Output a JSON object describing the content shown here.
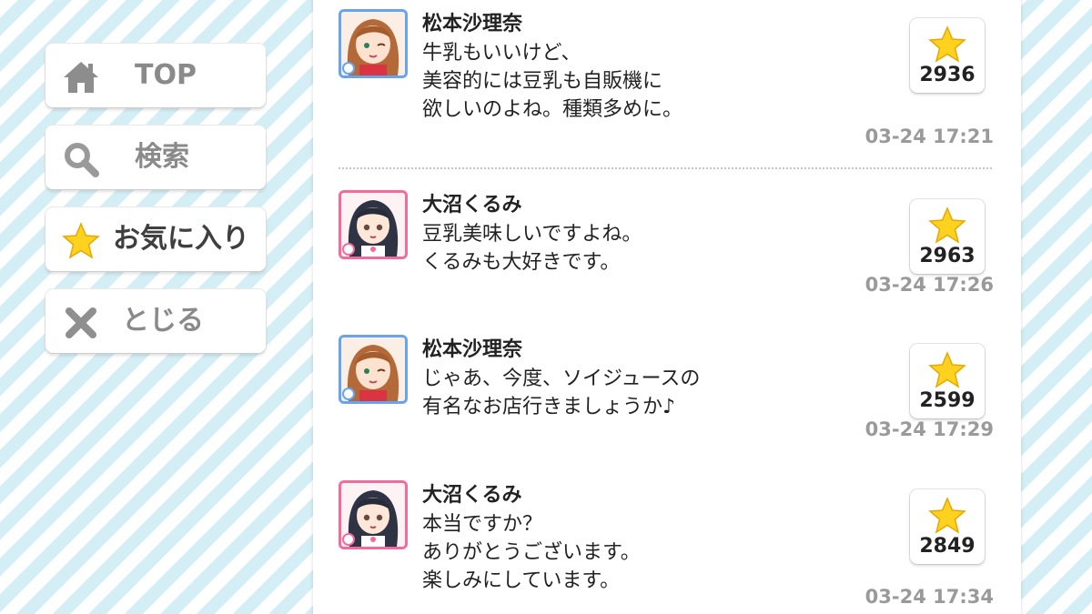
{
  "sidebar": {
    "items": [
      {
        "label": "TOP",
        "icon": "home-icon"
      },
      {
        "label": "検索",
        "icon": "search-icon"
      },
      {
        "label": "お気に入り",
        "icon": "star-icon"
      },
      {
        "label": "とじる",
        "icon": "close-icon"
      }
    ]
  },
  "colors": {
    "star": "#ffd700",
    "frame_blue": "#67a4ef",
    "frame_pink": "#f46a9d",
    "timestamp": "#9a9a9a"
  },
  "messages": [
    {
      "name": "松本沙理奈",
      "frame": "blue",
      "text": "牛乳もいいけど、\n美容的には豆乳も自販機に\n欲しいのよね。種類多めに。",
      "likes": "2936",
      "time": "03-24 17:21"
    },
    {
      "name": "大沼くるみ",
      "frame": "pink",
      "text": "豆乳美味しいですよね。\nくるみも大好きです。",
      "likes": "2963",
      "time": "03-24 17:26"
    },
    {
      "name": "松本沙理奈",
      "frame": "blue",
      "text": "じゃあ、今度、ソイジュースの\n有名なお店行きましょうか♪",
      "likes": "2599",
      "time": "03-24 17:29"
    },
    {
      "name": "大沼くるみ",
      "frame": "pink",
      "text": "本当ですか？\nありがとうございます。\n楽しみにしています。",
      "likes": "2849",
      "time": "03-24 17:34"
    }
  ]
}
